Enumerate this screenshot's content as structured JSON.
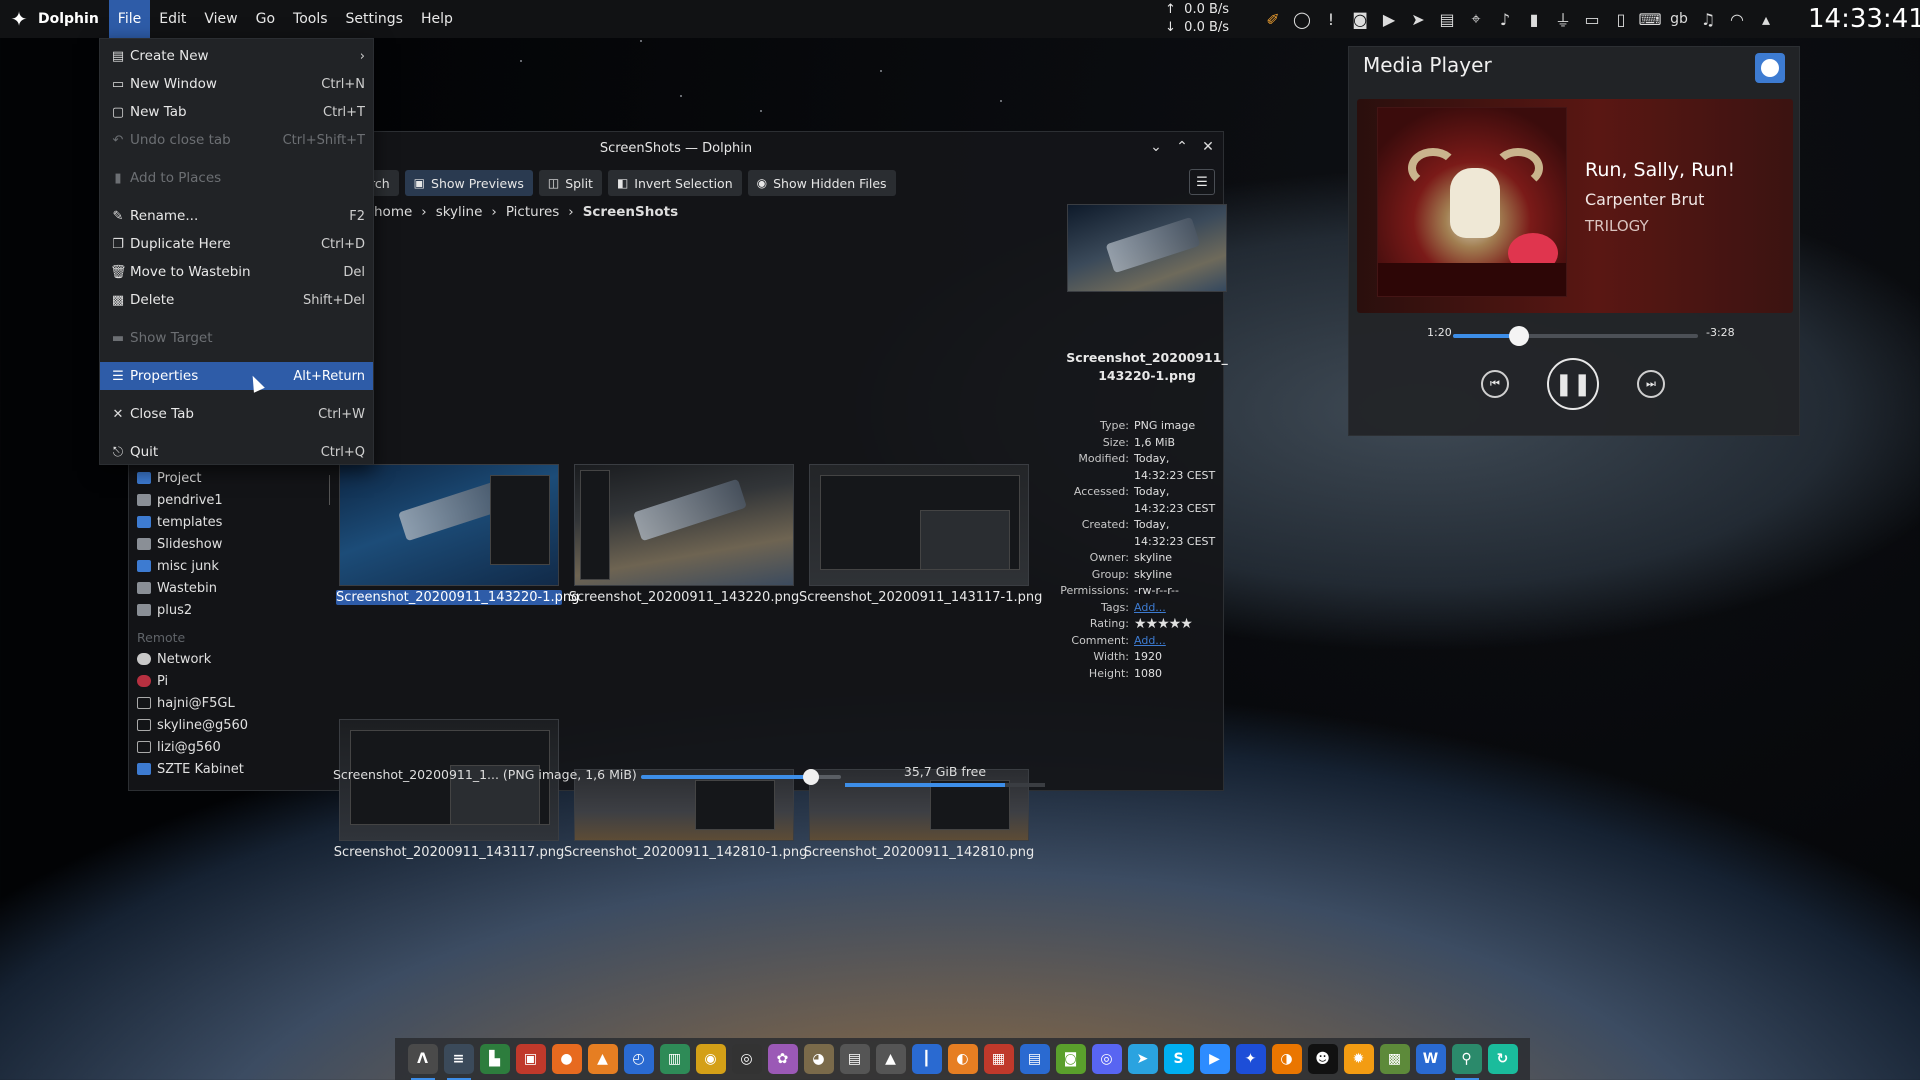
{
  "panel": {
    "app_name": "Dolphin",
    "menus": [
      "File",
      "Edit",
      "View",
      "Go",
      "Tools",
      "Settings",
      "Help"
    ],
    "active_menu": "File",
    "net_up": "0.0 B/s",
    "net_down": "0.0 B/s",
    "keyboard_layout": "gb",
    "clock": "14:33:41",
    "tray_icons": [
      "pen-icon",
      "circle-icon",
      "notification-icon",
      "discord-icon",
      "media-play-icon",
      "send-icon",
      "clipboard-icon",
      "location-icon",
      "volume-icon",
      "battery-icon",
      "usb-icon",
      "display-icon",
      "phone-icon",
      "keyboard-icon",
      "gb",
      "microphone-icon",
      "wifi-icon",
      "expand-tray-icon"
    ]
  },
  "file_menu": {
    "items": [
      {
        "icon": "document-new-icon",
        "label": "Create New",
        "shortcut": "",
        "submenu": true,
        "disabled": false
      },
      {
        "icon": "window-new-icon",
        "label": "New Window",
        "shortcut": "Ctrl+N",
        "disabled": false
      },
      {
        "icon": "tab-new-icon",
        "label": "New Tab",
        "shortcut": "Ctrl+T",
        "disabled": false
      },
      {
        "icon": "undo-icon",
        "label": "Undo close tab",
        "shortcut": "Ctrl+Shift+T",
        "disabled": true
      },
      {
        "icon": "bookmark-icon",
        "label": "Add to Places",
        "shortcut": "",
        "disabled": true
      },
      {
        "icon": "rename-icon",
        "label": "Rename...",
        "shortcut": "F2",
        "disabled": false
      },
      {
        "icon": "duplicate-icon",
        "label": "Duplicate Here",
        "shortcut": "Ctrl+D",
        "disabled": false
      },
      {
        "icon": "trash-icon",
        "label": "Move to Wastebin",
        "shortcut": "Del",
        "disabled": false
      },
      {
        "icon": "delete-icon",
        "label": "Delete",
        "shortcut": "Shift+Del",
        "disabled": false
      },
      {
        "icon": "folder-icon",
        "label": "Show Target",
        "shortcut": "",
        "disabled": true
      },
      {
        "icon": "properties-icon",
        "label": "Properties",
        "shortcut": "Alt+Return",
        "disabled": false,
        "selected": true
      },
      {
        "icon": "close-icon",
        "label": "Close Tab",
        "shortcut": "Ctrl+W",
        "disabled": false
      },
      {
        "icon": "quit-icon",
        "label": "Quit",
        "shortcut": "Ctrl+Q",
        "disabled": false
      }
    ]
  },
  "dolphin": {
    "window_title": "ScreenShots — Dolphin",
    "toolbar": {
      "search_partial": "rch",
      "show_previews": "Show Previews",
      "split": "Split",
      "invert_selection": "Invert Selection",
      "show_hidden": "Show Hidden Files"
    },
    "breadcrumb": [
      "home",
      "skyline",
      "Pictures",
      "ScreenShots"
    ],
    "places": [
      {
        "label": "Project",
        "icon": "blue"
      },
      {
        "label": "pendrive1",
        "icon": "folder"
      },
      {
        "label": "templates",
        "icon": "blue"
      },
      {
        "label": "Slideshow",
        "icon": "folder"
      },
      {
        "label": "misc junk",
        "icon": "blue"
      },
      {
        "label": "Wastebin",
        "icon": "folder"
      },
      {
        "label": "plus2",
        "icon": "folder"
      }
    ],
    "remote_header": "Remote",
    "remote": [
      {
        "label": "Network",
        "icon": "globe"
      },
      {
        "label": "Pi",
        "icon": "red"
      },
      {
        "label": "hajni@F5GL",
        "icon": "box"
      },
      {
        "label": "skyline@g560",
        "icon": "box"
      },
      {
        "label": "lizi@g560",
        "icon": "box"
      },
      {
        "label": "SZTE Kabinet",
        "icon": "blue"
      }
    ],
    "files": [
      "Screenshot_20200911_143220-1.png",
      "Screenshot_20200911_143220.png",
      "Screenshot_20200911_143117-1.png",
      "Screenshot_20200911_143117.png",
      "Screenshot_20200911_142810-1.png",
      "Screenshot_20200911_142810.png"
    ],
    "selected_file_index": 0,
    "info": {
      "title_line1": "Screenshot_20200911_",
      "title_line2": "143220-1.png",
      "rows": [
        {
          "k": "Type:",
          "v": "PNG image"
        },
        {
          "k": "Size:",
          "v": "1,6 MiB"
        },
        {
          "k": "Modified:",
          "v": "Today,"
        },
        {
          "k": "",
          "v": "14:32:23 CEST"
        },
        {
          "k": "Accessed:",
          "v": "Today,"
        },
        {
          "k": "",
          "v": "14:32:23 CEST"
        },
        {
          "k": "Created:",
          "v": "Today,"
        },
        {
          "k": "",
          "v": "14:32:23 CEST"
        },
        {
          "k": "Owner:",
          "v": "skyline"
        },
        {
          "k": "Group:",
          "v": "skyline"
        },
        {
          "k": "Permissions:",
          "v": "-rw-r--r--"
        },
        {
          "k": "Tags:",
          "v": "Add...",
          "link": true
        },
        {
          "k": "Rating:",
          "v": "★★★★★",
          "stars": true
        },
        {
          "k": "Comment:",
          "v": "Add...",
          "link": true
        },
        {
          "k": "Width:",
          "v": "1920"
        },
        {
          "k": "Height:",
          "v": "1080"
        }
      ]
    },
    "status_text": "Screenshot_20200911_1... (PNG image, 1,6 MiB)",
    "zoom_fraction": 0.85,
    "free_space": "35,7 GiB free",
    "used_fraction": 0.8
  },
  "media_player": {
    "title": "Media Player",
    "track": "Run, Sally, Run!",
    "artist": "Carpenter Brut",
    "album": "TRILOGY",
    "elapsed": "1:20",
    "remaining": "-3:28",
    "progress": 0.27
  },
  "taskbar": {
    "apps": [
      {
        "name": "sublime-icon",
        "glyph": "Λ",
        "color": "#4a4a4a",
        "active": true
      },
      {
        "name": "notes-icon",
        "glyph": "≡",
        "color": "#3b4a5a",
        "active": true
      },
      {
        "name": "files-icon",
        "glyph": "▙",
        "color": "#2d7d3d"
      },
      {
        "name": "calendar-icon",
        "glyph": "▣",
        "color": "#c0392b"
      },
      {
        "name": "firefox-icon",
        "glyph": "●",
        "color": "#e76a1f"
      },
      {
        "name": "vlc-icon",
        "glyph": "▲",
        "color": "#e67e22"
      },
      {
        "name": "clock-icon",
        "glyph": "◴",
        "color": "#2a6ad1"
      },
      {
        "name": "monitor-icon",
        "glyph": "▥",
        "color": "#2e8b57"
      },
      {
        "name": "music-icon",
        "glyph": "◉",
        "color": "#d4a017"
      },
      {
        "name": "obs-icon",
        "glyph": "◎",
        "color": "#333"
      },
      {
        "name": "palette-icon",
        "glyph": "✿",
        "color": "#9b59b6"
      },
      {
        "name": "gimp-icon",
        "glyph": "◕",
        "color": "#7a6a4a"
      },
      {
        "name": "usb-device-icon",
        "glyph": "▤",
        "color": "#555"
      },
      {
        "name": "upload-icon",
        "glyph": "▲",
        "color": "#555"
      },
      {
        "name": "ruler-icon",
        "glyph": "┃",
        "color": "#2a6ad1"
      },
      {
        "name": "blender-icon",
        "glyph": "◐",
        "color": "#e67e22"
      },
      {
        "name": "archive-icon",
        "glyph": "▦",
        "color": "#c0392b"
      },
      {
        "name": "document-icon",
        "glyph": "▤",
        "color": "#2a6ad1"
      },
      {
        "name": "android-icon",
        "glyph": "◙",
        "color": "#5aa02c"
      },
      {
        "name": "discord-icon",
        "glyph": "◎",
        "color": "#5865f2"
      },
      {
        "name": "telegram-icon",
        "glyph": "➤",
        "color": "#2aa3e0"
      },
      {
        "name": "skype-icon",
        "glyph": "S",
        "color": "#00aff0"
      },
      {
        "name": "zoom-icon",
        "glyph": "▶",
        "color": "#2d8cff"
      },
      {
        "name": "kdeconnect-icon",
        "glyph": "✦",
        "color": "#1d4ed8"
      },
      {
        "name": "blender2-icon",
        "glyph": "◑",
        "color": "#ea7600"
      },
      {
        "name": "avatar-icon",
        "glyph": "☻",
        "color": "#111"
      },
      {
        "name": "settings-icon",
        "glyph": "✹",
        "color": "#f39c12"
      },
      {
        "name": "minecraft-icon",
        "glyph": "▩",
        "color": "#5d8a3a"
      },
      {
        "name": "ksysguard-icon",
        "glyph": "W",
        "color": "#2a6ad1"
      },
      {
        "name": "tool-icon",
        "glyph": "⚲",
        "color": "#2b8a6b",
        "active": true
      },
      {
        "name": "refresh-icon",
        "glyph": "↻",
        "color": "#1abc9c"
      }
    ]
  }
}
